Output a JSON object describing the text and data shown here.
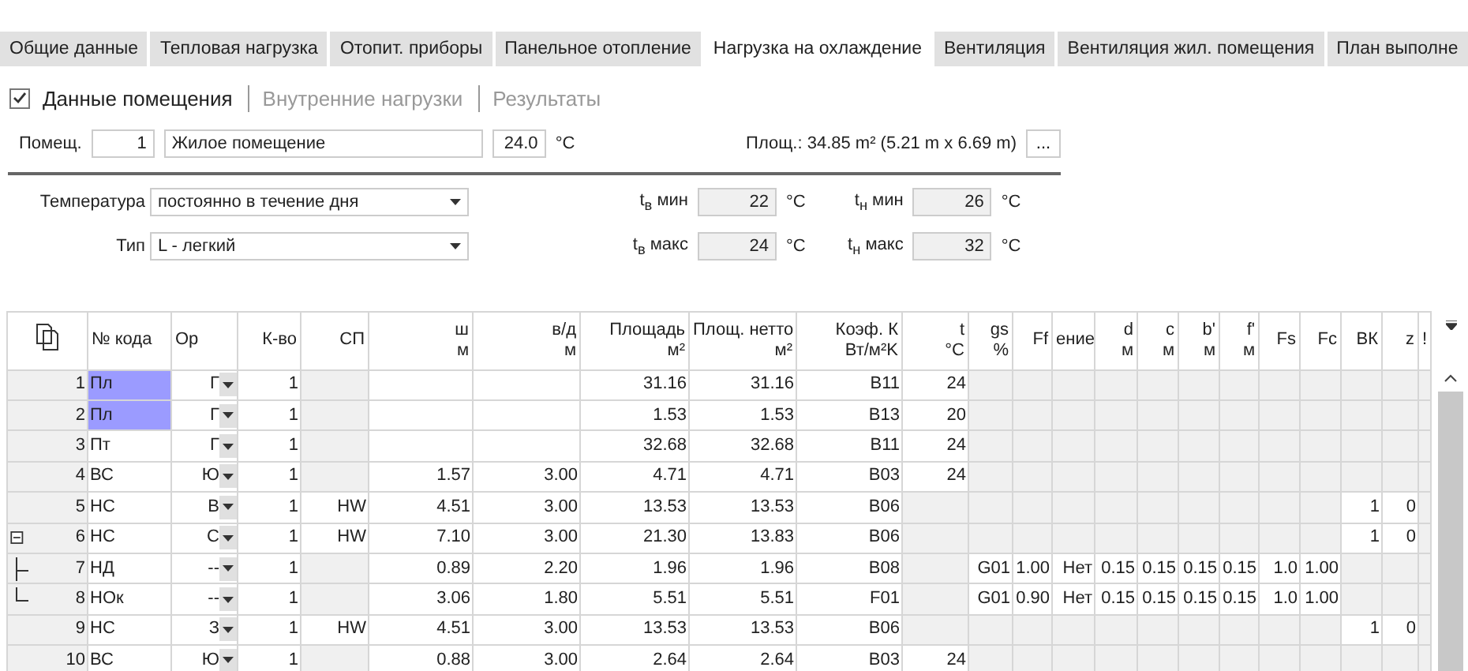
{
  "tabs": [
    {
      "label": "Общие данные",
      "selected": false
    },
    {
      "label": "Тепловая нагрузка",
      "selected": false
    },
    {
      "label": "Отопит. приборы",
      "selected": false
    },
    {
      "label": "Панельное отопление",
      "selected": false
    },
    {
      "label": "Нагрузка на охлаждение",
      "selected": true
    },
    {
      "label": "Вентиляция",
      "selected": false
    },
    {
      "label": "Вентиляция жил. помещения",
      "selected": false
    },
    {
      "label": "План выполне",
      "selected": false
    }
  ],
  "subtabs": {
    "checked": true,
    "items": [
      {
        "label": "Данные помещения",
        "selected": true
      },
      {
        "label": "Внутренние нагрузки",
        "selected": false
      },
      {
        "label": "Результаты",
        "selected": false
      }
    ]
  },
  "room": {
    "label": "Помещ.",
    "number": "1",
    "name": "Жилое помещение",
    "temperature": "24.0",
    "unit": "°C",
    "area": "Площ.: 34.85  m² (5.21 m x 6.69 m)",
    "more_button": "..."
  },
  "settings": [
    {
      "label": "Температура",
      "value": "постоянно в течение дня",
      "fields": [
        {
          "label": "t$_{в}$ мин",
          "value": "22",
          "unit": "°C"
        },
        {
          "label": "t$_{н}$ мин",
          "value": "26",
          "unit": "°C"
        }
      ]
    },
    {
      "label": "Тип",
      "value": "L - легкий",
      "fields": [
        {
          "label": "t$_{в}$ макс",
          "value": "24",
          "unit": "°C"
        },
        {
          "label": "t$_{н}$ макс",
          "value": "32",
          "unit": "°C"
        }
      ]
    }
  ],
  "table": {
    "columns": [
      {
        "label": "№ кода"
      },
      {
        "label": "Ор"
      },
      {
        "label": "К-во"
      },
      {
        "label": "СП"
      },
      {
        "label": "ш",
        "unit": "м"
      },
      {
        "label": "в/д",
        "unit": "м"
      },
      {
        "label": "Площадь",
        "unit": "м²"
      },
      {
        "label": "Площ. нетто",
        "unit": "м²"
      },
      {
        "label": "Коэф. К",
        "unit": "Вт/м²K"
      },
      {
        "label": "t",
        "unit": "°C"
      },
      {
        "label": "gs",
        "unit": "%"
      },
      {
        "label": "Ff"
      },
      {
        "label": "ение"
      },
      {
        "label": "d",
        "unit": "м"
      },
      {
        "label": "c",
        "unit": "м"
      },
      {
        "label": "b'",
        "unit": "м"
      },
      {
        "label": "f'",
        "unit": "м"
      },
      {
        "label": "Fs"
      },
      {
        "label": "Fc"
      },
      {
        "label": "ВК"
      },
      {
        "label": "z"
      },
      {
        "label": "!"
      }
    ],
    "rows": [
      {
        "number": "1",
        "selected": true,
        "cells": [
          "Пл",
          "Г",
          "1",
          "",
          "",
          "",
          "31.16",
          "31.16",
          "B11",
          "24",
          "",
          "",
          "",
          "",
          "",
          "",
          "",
          "",
          "",
          "",
          ""
        ]
      },
      {
        "number": "2",
        "selected": true,
        "cells": [
          "Пл",
          "Г",
          "1",
          "",
          "",
          "",
          "1.53",
          "1.53",
          "B13",
          "20",
          "",
          "",
          "",
          "",
          "",
          "",
          "",
          "",
          "",
          "",
          ""
        ]
      },
      {
        "number": "3",
        "selected": false,
        "cells": [
          "Пт",
          "Г",
          "1",
          "",
          "",
          "",
          "32.68",
          "32.68",
          "B11",
          "24",
          "",
          "",
          "",
          "",
          "",
          "",
          "",
          "",
          "",
          "",
          ""
        ]
      },
      {
        "number": "4",
        "selected": false,
        "cells": [
          "ВС",
          "Ю",
          "1",
          "",
          "1.57",
          "3.00",
          "4.71",
          "4.71",
          "B03",
          "24",
          "",
          "",
          "",
          "",
          "",
          "",
          "",
          "",
          "",
          "",
          ""
        ]
      },
      {
        "number": "5",
        "selected": false,
        "cells": [
          "НС",
          "В",
          "1",
          "HW",
          "4.51",
          "3.00",
          "13.53",
          "13.53",
          "B06",
          "",
          "",
          "",
          "",
          "",
          "",
          "",
          "",
          "",
          "",
          "1",
          "0"
        ]
      },
      {
        "number": "6",
        "selected": false,
        "expanded": true,
        "cells": [
          "НС",
          "С",
          "1",
          "HW",
          "7.10",
          "3.00",
          "21.30",
          "13.83",
          "B06",
          "",
          "",
          "",
          "",
          "",
          "",
          "",
          "",
          "",
          "",
          "1",
          "0"
        ],
        "children": [
          {
            "number": "7",
            "selected": false,
            "cells": [
              "НД",
              "--",
              "1",
              "",
              "0.89",
              "2.20",
              "1.96",
              "1.96",
              "B08",
              "",
              "G01",
              "1.00",
              "Нет",
              "0.15",
              "0.15",
              "0.15",
              "0.15",
              "1.0",
              "1.00",
              "",
              ""
            ]
          },
          {
            "number": "8",
            "selected": false,
            "cells": [
              "НОк",
              "--",
              "1",
              "",
              "3.06",
              "1.80",
              "5.51",
              "5.51",
              "F01",
              "",
              "G01",
              "0.90",
              "Нет",
              "0.15",
              "0.15",
              "0.15",
              "0.15",
              "1.0",
              "1.00",
              "",
              ""
            ]
          }
        ]
      },
      {
        "number": "9",
        "selected": false,
        "cells": [
          "НС",
          "З",
          "1",
          "HW",
          "4.51",
          "3.00",
          "13.53",
          "13.53",
          "B06",
          "",
          "",
          "",
          "",
          "",
          "",
          "",
          "",
          "",
          "",
          "1",
          "0"
        ]
      },
      {
        "number": "10",
        "selected": false,
        "cells": [
          "ВС",
          "Ю",
          "1",
          "",
          "0.88",
          "3.00",
          "2.64",
          "2.64",
          "B03",
          "24",
          "",
          "",
          "",
          "",
          "",
          "",
          "",
          "",
          "",
          "",
          ""
        ]
      }
    ]
  }
}
